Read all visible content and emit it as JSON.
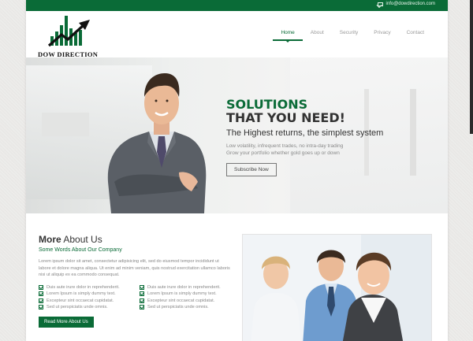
{
  "topbar": {
    "email": "info@dowdirection.com"
  },
  "logo": {
    "text": "DOW DIRECTION"
  },
  "nav": {
    "items": [
      "Home",
      "About",
      "Security",
      "Privacy",
      "Contact"
    ],
    "active": "Home"
  },
  "hero": {
    "line1": "SOLUTIONS",
    "line2": "THAT YOU NEED!",
    "subtitle": "The Highest returns, the simplest system",
    "desc1": "Low volatility, infrequent trades, no intra-day trading",
    "desc2": "Grow your portfolio whether gold goes up or down",
    "button": "Subscribe Now"
  },
  "about": {
    "title_bold": "More",
    "title_rest": "About Us",
    "subtitle": "Some Words About Our Company",
    "body": "Lorem ipsum dolor sit amet, consectetur adipisicing elit, sed do eiusmod tempor incididunt ut labore et dolore magna aliqua. Ut enim ad minim veniam, quis nostrud exercitation ullamco laboris nisi ut aliquip ex ea commodo consequat.",
    "checks_left": [
      "Duis aute irure dolor in reprehenderit.",
      "Lorem Ipsum is simply dummy text.",
      "Excepteur sint occaecat cupidatat.",
      "Sed ut perspiciatis unde omnis."
    ],
    "checks_right": [
      "Duis aute irure dolor in reprehenderit.",
      "Lorem Ipsum is simply dummy text.",
      "Excepteur sint occaecat cupidatat.",
      "Sed ut perspiciatis unde omnis."
    ],
    "button": "Read More About Us"
  },
  "colors": {
    "brand": "#0a6b37",
    "heading": "#333333",
    "muted": "#888888"
  },
  "icons": {
    "email": "envelope-icon",
    "check": "checkbox-icon"
  }
}
